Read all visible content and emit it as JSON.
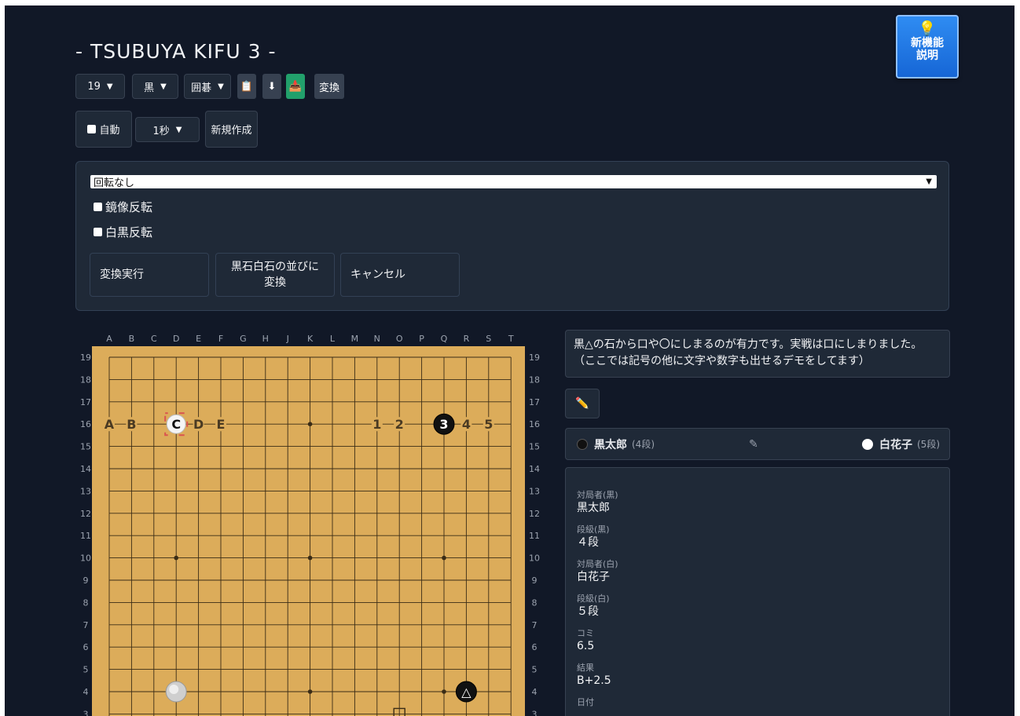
{
  "title": "- TSUBUYA KIFU 3 -",
  "new_feature": {
    "line1": "新機能",
    "line2": "説明",
    "icon": "lightbulb-icon"
  },
  "toolbar": {
    "size": "19",
    "color": "黒",
    "game": "囲碁",
    "clipboard_icon": "clipboard-icon",
    "download_icon": "download-icon",
    "upload_icon": "upload-icon",
    "convert": "変換"
  },
  "auto": {
    "label": "自動",
    "interval": "1秒",
    "new": "新規作成"
  },
  "transform": {
    "rotation": "回転なし",
    "mirror": "鏡像反転",
    "invert": "白黒反転",
    "execute": "変換実行",
    "to_sequence": "黒石白石の並びに\n変換",
    "cancel": "キャンセル"
  },
  "board": {
    "cols": [
      "A",
      "B",
      "C",
      "D",
      "E",
      "F",
      "G",
      "H",
      "J",
      "K",
      "L",
      "M",
      "N",
      "O",
      "P",
      "Q",
      "R",
      "S",
      "T"
    ],
    "rows": [
      "19",
      "18",
      "17",
      "16",
      "15",
      "14",
      "13",
      "12",
      "11",
      "10",
      "9",
      "8",
      "7",
      "6",
      "5",
      "4",
      "3"
    ],
    "stones": [
      {
        "col": "D",
        "row": 16,
        "color": "white",
        "label": "C"
      },
      {
        "col": "Q",
        "row": 16,
        "color": "black",
        "label": "3"
      },
      {
        "col": "D",
        "row": 4,
        "color": "white",
        "label": ""
      },
      {
        "col": "R",
        "row": 4,
        "color": "black",
        "label": "△"
      }
    ],
    "text_marks": [
      {
        "col": "A",
        "row": 16,
        "label": "A"
      },
      {
        "col": "B",
        "row": 16,
        "label": "B"
      },
      {
        "col": "E",
        "row": 16,
        "label": "D"
      },
      {
        "col": "F",
        "row": 16,
        "label": "E"
      },
      {
        "col": "N",
        "row": 16,
        "label": "1"
      },
      {
        "col": "O",
        "row": 16,
        "label": "2"
      },
      {
        "col": "R",
        "row": 16,
        "label": "4"
      },
      {
        "col": "S",
        "row": 16,
        "label": "5"
      }
    ],
    "square_mark": {
      "col": "O",
      "row": 3
    }
  },
  "comment": "黒△の石から口や〇にしまるのが有力です。実戦は口にしまりました。\n（ここでは記号の他に文字や数字も出せるデモをしてます）",
  "edit_icon": "pencil-icon",
  "players": {
    "black_name": "黒太郎",
    "black_rank": "(4段)",
    "white_name": "白花子",
    "white_rank": "(5段)",
    "edit_icon": "pencil-icon"
  },
  "info": [
    {
      "label": "対局者(黒)",
      "value": "黒太郎"
    },
    {
      "label": "段級(黒)",
      "value": "４段"
    },
    {
      "label": "対局者(白)",
      "value": "白花子"
    },
    {
      "label": "段級(白)",
      "value": "５段"
    },
    {
      "label": "コミ",
      "value": "6.5"
    },
    {
      "label": "結果",
      "value": "B+2.5"
    },
    {
      "label": "日付",
      "value": ""
    }
  ]
}
